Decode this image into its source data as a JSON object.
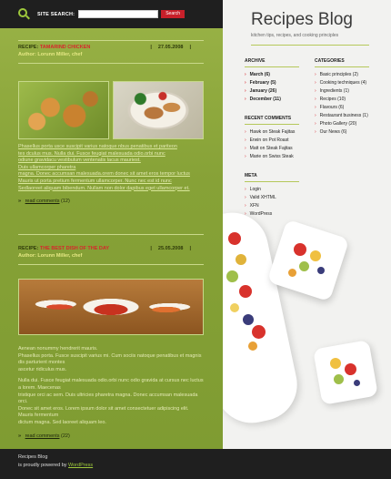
{
  "search": {
    "label": "SITE SEARCH:",
    "button": "Search",
    "value": ""
  },
  "posts": [
    {
      "title_prefix": "RECIPE: ",
      "title_accent": "TAMARIND CHICKEN",
      "date": "27.05.2008",
      "author": "Author: Lorunn Miller, chef",
      "text_lines": [
        "Phasellus porta usce suscipit varius natoque nbus penatibus et pariteon",
        "tes dculus mus. Nulla dui. Fusce feugiat malesuada odio.orbi nunc",
        "odiune gravidacu vestibulum ventenatis lacus mauriest.",
        "Duis ullamcorper pharetra",
        "magna. Donec accumsan malesuada.orem donec sit amet eros tempor luctus",
        "Mauris ut porta pretium fermentum ullamcorper. Nunc nec est id nunc",
        "Sedlaoreet aliquam bibendum. Nullam non dolor dapibus eget ullamcorper et."
      ],
      "comments_label": "read comments",
      "comments_count": "(12)"
    },
    {
      "title_prefix": "RECIPE: ",
      "title_accent": "THE BEST DISH OF THE DAY",
      "date": "25.05.2008",
      "author": "Author: Lorunn Miller, chef",
      "text_lines": [
        "Aenean nonummy hendrerit mauris.",
        "Phasellus porta. Fusce suscipit varius mi. Cum sociis natoque penatibus et magnis dis parturient montes",
        "ascetur ridiculus mus.",
        "Nulla dui. Fusce feugiat malesuada odio.orbi nunc odio gravida at cursus nec luctus a lorem. Maecenas",
        "tristique orci ac sem. Duis ultricies pharetra magna. Donec accumsan malesuada orci.",
        "Donec sit amet eros. Lorem ipsum dolor sit amet consectetuer adipiscing elit. Mauris fermentum",
        "dictum magna. Sed laoreet aliquam leo."
      ],
      "comments_label": "read comments",
      "comments_count": "(22)"
    }
  ],
  "blog": {
    "title": "Recipes Blog",
    "tagline": "kitchen tips, recipes, and cooking principles"
  },
  "archive": {
    "title": "ARCHIVE",
    "items": [
      "March (6)",
      "February (5)",
      "January (26)",
      "December (11)"
    ]
  },
  "categories": {
    "title": "CATEGORIES",
    "items": [
      "Basic principles (2)",
      "Cooking techniques (4)",
      "Ingredients (1)",
      "Recipes (10)",
      "Flavours (6)",
      "Restaurant business (1)",
      "Photo Gallery (20)",
      "Our News (6)"
    ]
  },
  "recent_comments": {
    "title": "RECENT COMMENTS",
    "items": [
      "Hawk on Steak Fajitas",
      "Erwin on Pot Roast",
      "Matt on Steak Fajitas",
      "Marie on Swiss Steak"
    ]
  },
  "meta": {
    "title": "META",
    "items": [
      "Login",
      "Valid XHTML",
      "XFN",
      "WordPress"
    ]
  },
  "footer": {
    "title": "Recipes Blog",
    "powered_prefix": "is proudly powered by ",
    "powered_link": "WordPress"
  },
  "colors": {
    "accent_red": "#d7262c",
    "green": "#8ba63c",
    "dark": "#1f1f1f"
  }
}
